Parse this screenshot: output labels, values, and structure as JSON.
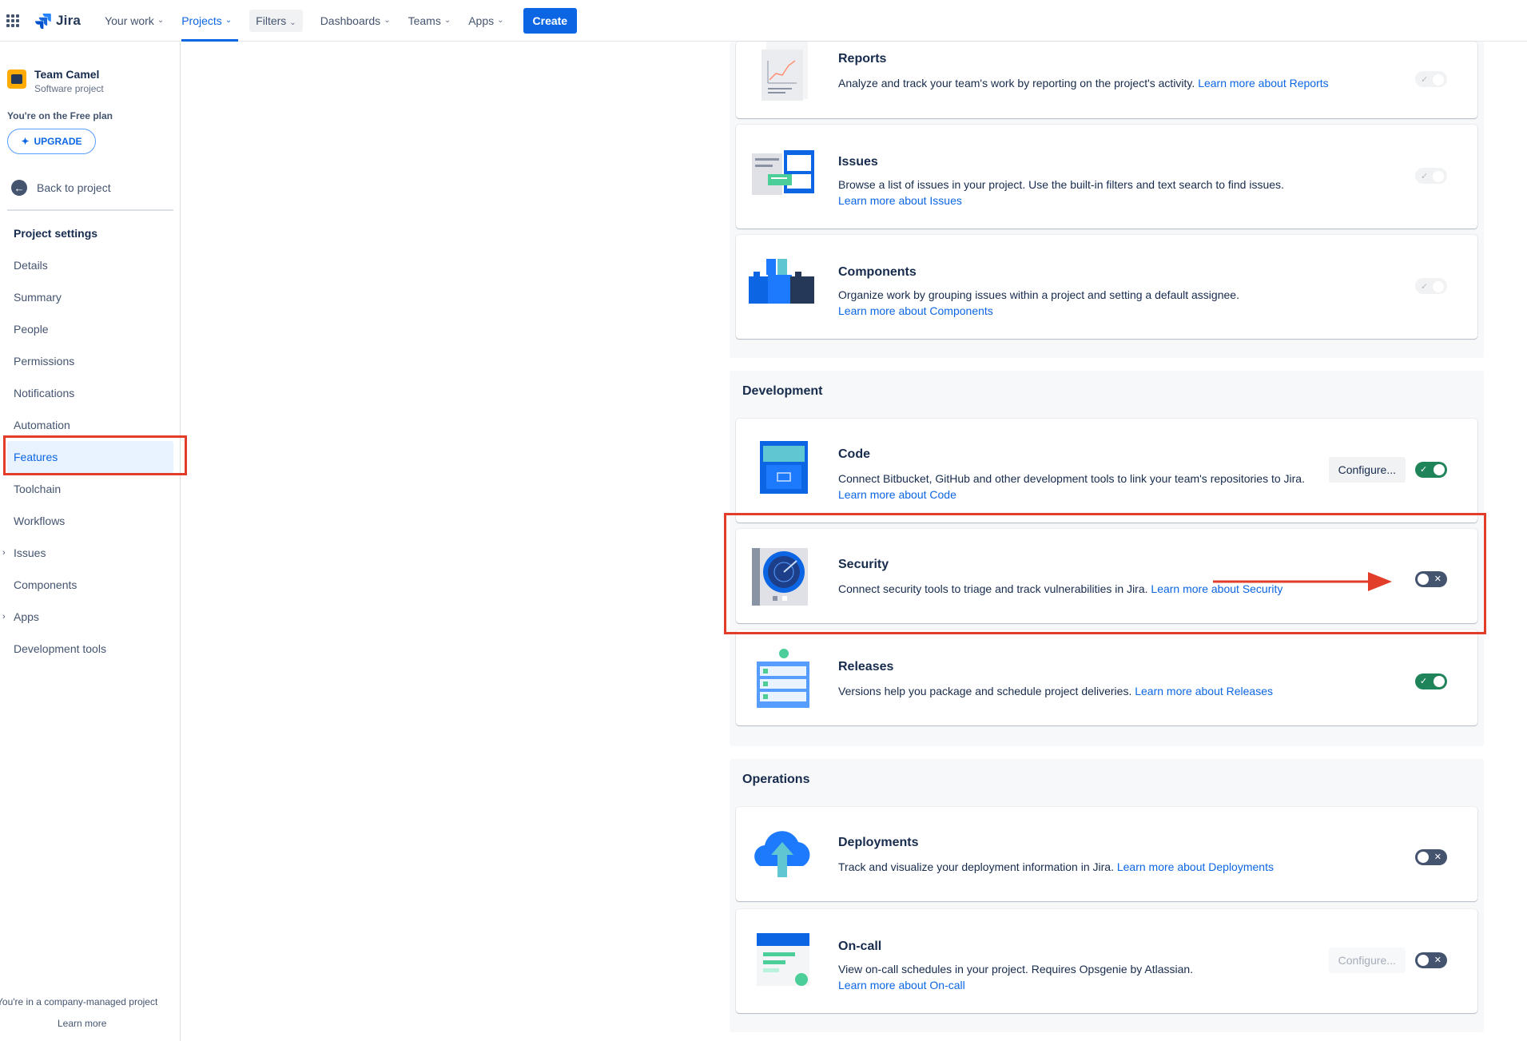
{
  "topnav": {
    "logo_text": "Jira",
    "items": [
      {
        "label": "Your work"
      },
      {
        "label": "Projects"
      },
      {
        "label": "Filters"
      },
      {
        "label": "Dashboards"
      },
      {
        "label": "Teams"
      },
      {
        "label": "Apps"
      }
    ],
    "active_item": "Projects",
    "create_label": "Create"
  },
  "sidebar": {
    "project_name": "Team Camel",
    "project_type": "Software project",
    "plan_text": "You're on the Free plan",
    "upgrade_label": "UPGRADE",
    "back_label": "Back to project",
    "heading": "Project settings",
    "items": [
      {
        "label": "Details"
      },
      {
        "label": "Summary"
      },
      {
        "label": "People"
      },
      {
        "label": "Permissions"
      },
      {
        "label": "Notifications"
      },
      {
        "label": "Automation"
      },
      {
        "label": "Features"
      },
      {
        "label": "Toolchain"
      },
      {
        "label": "Workflows"
      },
      {
        "label": "Issues"
      },
      {
        "label": "Components"
      },
      {
        "label": "Apps"
      },
      {
        "label": "Development tools"
      }
    ],
    "selected_item": "Features",
    "footer_line1": "You're in a company-managed project",
    "footer_line2": "Learn more"
  },
  "groups": {
    "development_title": "Development",
    "operations_title": "Operations"
  },
  "features": {
    "reports": {
      "title": "Reports",
      "desc": "Analyze and track your team's work by reporting on the project's activity. ",
      "link": "Learn more about Reports",
      "state": "on-disabled"
    },
    "issues": {
      "title": "Issues",
      "desc": "Browse a list of issues in your project. Use the built-in filters and text search to find issues.",
      "link": "Learn more about Issues",
      "state": "on-disabled"
    },
    "components": {
      "title": "Components",
      "desc": "Organize work by grouping issues within a project and setting a default assignee.",
      "link": "Learn more about Components",
      "state": "on-disabled"
    },
    "code": {
      "title": "Code",
      "desc": "Connect Bitbucket, GitHub and other development tools to link your team's repositories to Jira. ",
      "link": "Learn more about Code",
      "configure": "Configure...",
      "state": "on"
    },
    "security": {
      "title": "Security",
      "desc": "Connect security tools to triage and track vulnerabilities in Jira. ",
      "link": "Learn more about Security",
      "state": "off"
    },
    "releases": {
      "title": "Releases",
      "desc": "Versions help you package and schedule project deliveries. ",
      "link": "Learn more about Releases",
      "state": "on"
    },
    "deployments": {
      "title": "Deployments",
      "desc": "Track and visualize your deployment information in Jira. ",
      "link": "Learn more about Deployments",
      "state": "off"
    },
    "oncall": {
      "title": "On-call",
      "desc": "View on-call schedules in your project. Requires Opsgenie by Atlassian.",
      "link": "Learn more about On-call",
      "configure": "Configure...",
      "state": "off"
    }
  },
  "colors": {
    "brand_blue": "#0c66e4",
    "toggle_on": "#1f845a",
    "toggle_off": "#44546f",
    "highlight_red": "#e23d28"
  }
}
